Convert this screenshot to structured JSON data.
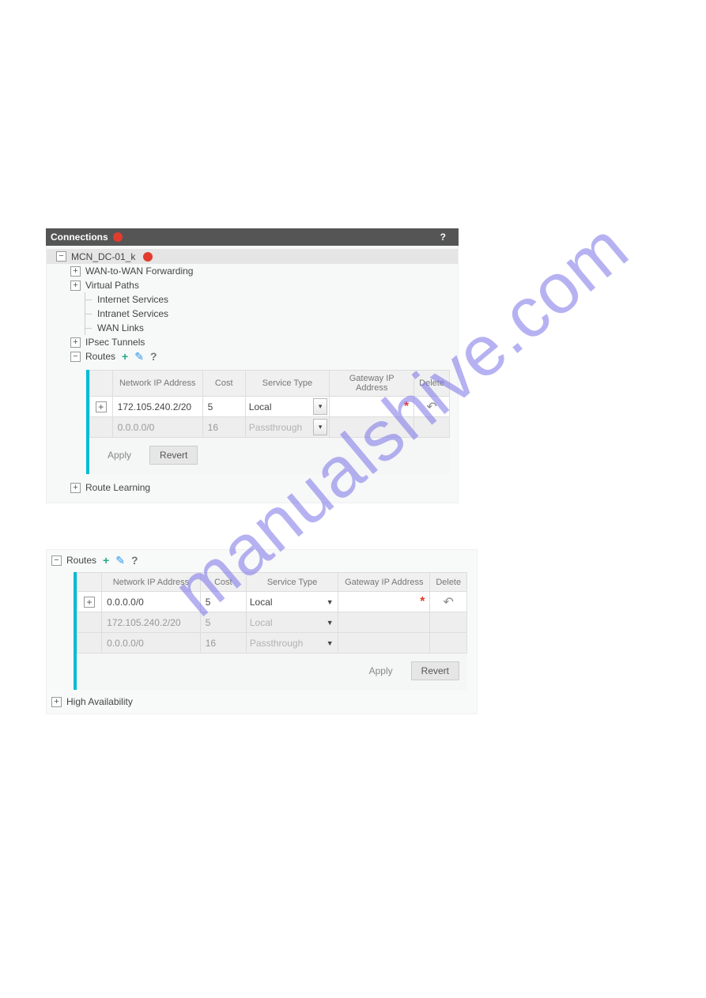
{
  "watermark": "manualshive.com",
  "panel1": {
    "header": "Connections",
    "help": "?",
    "site": "MCN_DC-01_k",
    "tree": {
      "wan_fwd": "WAN-to-WAN Forwarding",
      "vpaths": "Virtual Paths",
      "iservices": "Internet Services",
      "intra": "Intranet Services",
      "wlinks": "WAN Links",
      "ipsec": "IPsec Tunnels",
      "routes": "Routes",
      "route_learn": "Route Learning"
    },
    "icons": {
      "plus": "+",
      "pencil": "✎",
      "help": "?"
    },
    "table": {
      "cols": {
        "ip": "Network IP Address",
        "cost": "Cost",
        "stype": "Service Type",
        "gw": "Gateway IP Address",
        "del": "Delete"
      },
      "rows": [
        {
          "ip": "172.105.240.2/20",
          "cost": "5",
          "stype": "Local",
          "gw": "",
          "gw_required": true,
          "editable": true
        },
        {
          "ip": "0.0.0.0/0",
          "cost": "16",
          "stype": "Passthrough",
          "gw": "",
          "editable": false
        }
      ]
    },
    "buttons": {
      "apply": "Apply",
      "revert": "Revert"
    }
  },
  "panel2": {
    "routes": "Routes",
    "ha": "High Availability",
    "icons": {
      "plus": "+",
      "pencil": "✎",
      "help": "?"
    },
    "table": {
      "cols": {
        "ip": "Network IP Address",
        "cost": "Cost",
        "stype": "Service Type",
        "gw": "Gateway IP Address",
        "del": "Delete"
      },
      "rows": [
        {
          "ip": "0.0.0.0/0",
          "cost": "5",
          "stype": "Local",
          "gw": "",
          "gw_required": true,
          "editable": true,
          "show_expand": true,
          "show_revert": true
        },
        {
          "ip": "172.105.240.2/20",
          "cost": "5",
          "stype": "Local",
          "gw": "",
          "editable": false
        },
        {
          "ip": "0.0.0.0/0",
          "cost": "16",
          "stype": "Passthrough",
          "gw": "",
          "editable": false
        }
      ]
    },
    "buttons": {
      "apply": "Apply",
      "revert": "Revert"
    }
  }
}
